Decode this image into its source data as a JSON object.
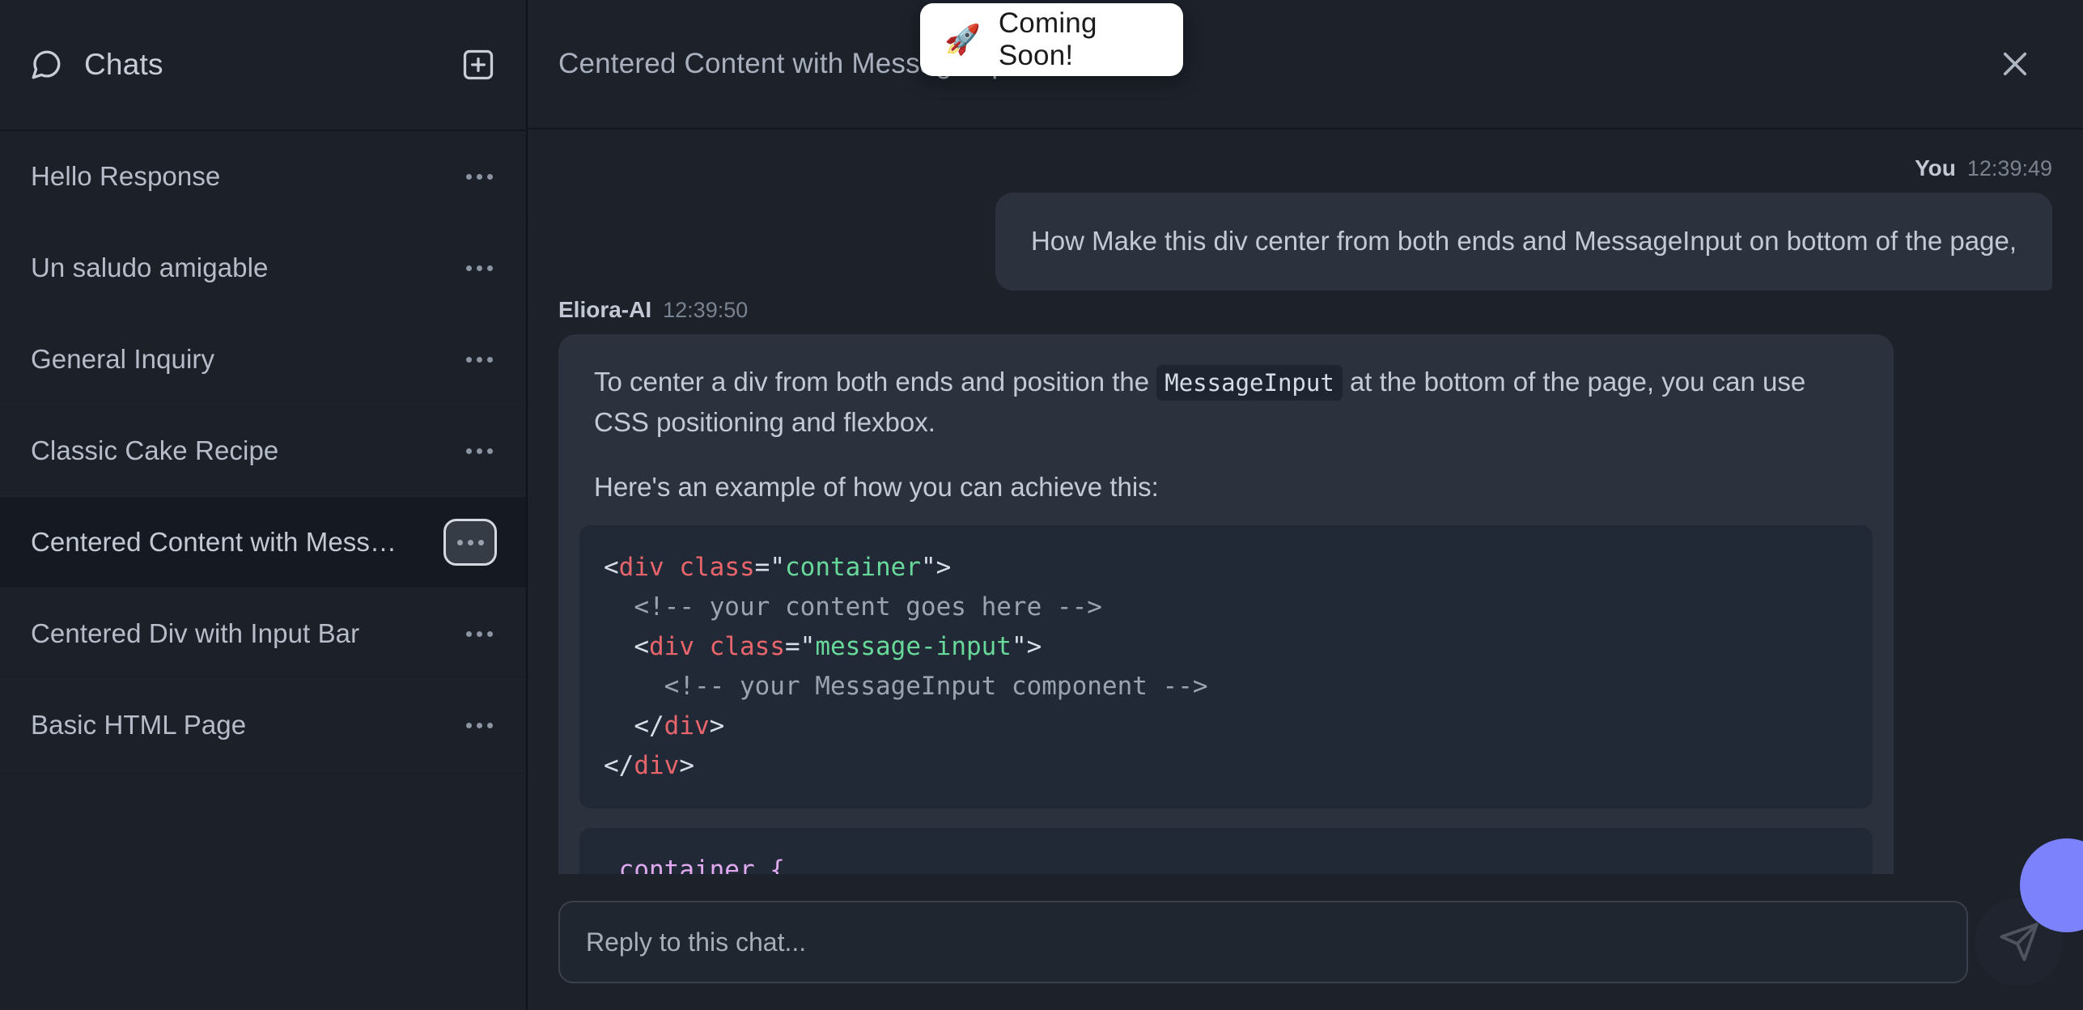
{
  "sidebar": {
    "title": "Chats",
    "icons": {
      "header": "chat-bubble-icon",
      "new_chat": "new-chat-plus-icon"
    },
    "items": [
      {
        "label": "Hello Response",
        "selected": false
      },
      {
        "label": "Un saludo amigable",
        "selected": false
      },
      {
        "label": "General Inquiry",
        "selected": false
      },
      {
        "label": "Classic Cake Recipe",
        "selected": false
      },
      {
        "label": "Centered Content with Messag...",
        "selected": true
      },
      {
        "label": "Centered Div with Input Bar",
        "selected": false
      },
      {
        "label": "Basic HTML Page",
        "selected": false
      }
    ]
  },
  "header": {
    "title": "Centered Content with MessageInput",
    "close_icon": "close-x-icon"
  },
  "toast": {
    "emoji": "🚀",
    "text": "Coming Soon!"
  },
  "conversation": {
    "user": {
      "author": "You",
      "time": "12:39:49",
      "text": "How Make this div center from both ends and MessageInput on bottom of the page,"
    },
    "ai": {
      "author": "Eliora-AI",
      "time": "12:39:50",
      "paragraph1_before": "To center a div from both ends and position the",
      "paragraph1_code": "MessageInput",
      "paragraph1_after": "at the bottom of the page, you can use CSS positioning and flexbox.",
      "paragraph2": "Here's an example of how you can achieve this:",
      "code_html": [
        {
          "indent": 0,
          "tokens": [
            {
              "t": "punct",
              "v": "<"
            },
            {
              "t": "tag",
              "v": "div"
            },
            {
              "t": "punct",
              "v": " "
            },
            {
              "t": "attr",
              "v": "class"
            },
            {
              "t": "eq",
              "v": "="
            },
            {
              "t": "punct",
              "v": "\""
            },
            {
              "t": "str",
              "v": "container"
            },
            {
              "t": "punct",
              "v": "\">"
            }
          ]
        },
        {
          "indent": 1,
          "tokens": [
            {
              "t": "comment",
              "v": "<!-- your content goes here -->"
            }
          ]
        },
        {
          "indent": 1,
          "tokens": [
            {
              "t": "punct",
              "v": "<"
            },
            {
              "t": "tag",
              "v": "div"
            },
            {
              "t": "punct",
              "v": " "
            },
            {
              "t": "attr",
              "v": "class"
            },
            {
              "t": "eq",
              "v": "="
            },
            {
              "t": "punct",
              "v": "\""
            },
            {
              "t": "str",
              "v": "message-input"
            },
            {
              "t": "punct",
              "v": "\">"
            }
          ]
        },
        {
          "indent": 2,
          "tokens": [
            {
              "t": "comment",
              "v": "<!-- your MessageInput component -->"
            }
          ]
        },
        {
          "indent": 1,
          "tokens": [
            {
              "t": "punct",
              "v": "</"
            },
            {
              "t": "tag",
              "v": "div"
            },
            {
              "t": "punct",
              "v": ">"
            }
          ]
        },
        {
          "indent": 0,
          "tokens": [
            {
              "t": "punct",
              "v": "</"
            },
            {
              "t": "tag",
              "v": "div"
            },
            {
              "t": "punct",
              "v": ">"
            }
          ]
        }
      ],
      "code_css": [
        {
          "indent": 0,
          "tokens": [
            {
              "t": "sel",
              "v": ".container {"
            }
          ]
        }
      ]
    }
  },
  "composer": {
    "placeholder": "Reply to this chat...",
    "value": "",
    "send_icon": "send-paper-plane-icon"
  },
  "fab": {
    "name": "floating-action-button",
    "color": "#7b82fb"
  },
  "colors": {
    "sidebar_bg": "#1b2029",
    "main_bg": "#1c212a",
    "bubble_bg": "#2b313d",
    "code_bg": "#222936",
    "accent": "#7b82fb",
    "tag": "#e8656b",
    "string": "#67d89a",
    "comment": "#9aa3b0",
    "selector": "#e0a9f0"
  }
}
